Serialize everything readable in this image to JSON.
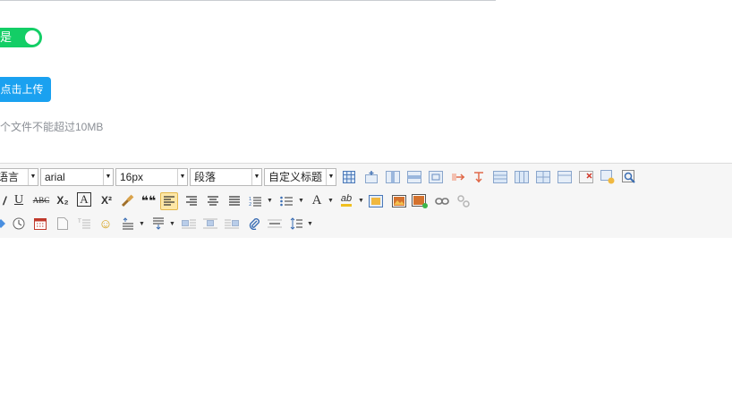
{
  "form": {
    "switch_label": "是",
    "upload_button": "点击上传",
    "upload_tip": "个文件不能超过10MB"
  },
  "editor": {
    "combos": {
      "language": "语言",
      "font_family": "arial",
      "font_size": "16px",
      "paragraph": "段落",
      "custom_title": "自定义标题"
    },
    "glyphs": {
      "underline": "U",
      "strike": "ABC",
      "subscript": "X₂",
      "border_char": "A",
      "superscript": "X²",
      "quote": "❝❝",
      "font_color": "A",
      "bg_color": "ab",
      "emoji": "☺"
    },
    "colors": {
      "active_bg": "#fde7a6",
      "switch_on": "#13ce66",
      "upload_btn": "#1aa1f0"
    }
  }
}
